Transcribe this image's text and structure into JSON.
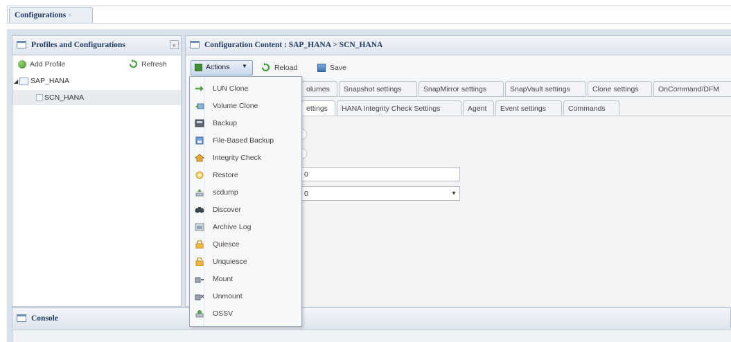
{
  "top_tab": {
    "label": "Configurations",
    "close_glyph": "×"
  },
  "left_panel": {
    "title": "Profiles and Configurations",
    "collapse_glyph": "«",
    "add_profile": "Add Profile",
    "refresh": "Refresh",
    "tree": [
      {
        "label": "SAP_HANA",
        "expanded": true
      },
      {
        "label": "SCN_HANA",
        "selected": true
      }
    ]
  },
  "right_panel": {
    "title": "Configuration Content : SAP_HANA > SCN_HANA",
    "toolbar": {
      "actions": "Actions",
      "reload": "Reload",
      "save": "Save"
    },
    "tabs_row1": [
      "olumes",
      "Snapshot settings",
      "SnapMirror settings",
      "SnapVault settings",
      "Clone settings",
      "OnCommand/DFM"
    ],
    "tabs_row2": [
      "ettings",
      "HANA Integrity Check Settings",
      "Agent",
      "Event settings",
      "Commands"
    ],
    "fields": {
      "text_value": "0",
      "select_value": "0"
    }
  },
  "actions_menu": [
    {
      "label": "LUN Clone",
      "icon": "lun-clone-icon"
    },
    {
      "label": "Volume Clone",
      "icon": "volume-clone-icon"
    },
    {
      "label": "Backup",
      "icon": "backup-icon"
    },
    {
      "label": "File-Based Backup",
      "icon": "file-backup-icon"
    },
    {
      "label": "Integrity Check",
      "icon": "integrity-check-icon"
    },
    {
      "label": "Restore",
      "icon": "restore-icon"
    },
    {
      "label": "scdump",
      "icon": "scdump-icon"
    },
    {
      "label": "Discover",
      "icon": "discover-icon"
    },
    {
      "label": "Archive Log",
      "icon": "archive-log-icon"
    },
    {
      "label": "Quiesce",
      "icon": "quiesce-icon"
    },
    {
      "label": "Unquiesce",
      "icon": "unquiesce-icon"
    },
    {
      "label": "Mount",
      "icon": "mount-icon"
    },
    {
      "label": "Unmount",
      "icon": "unmount-icon"
    },
    {
      "label": "OSSV",
      "icon": "ossv-icon"
    }
  ],
  "console": {
    "title": "Console"
  },
  "colors": {
    "header_text": "#1f3a63",
    "frame": "#d9e1ec",
    "menu_bg": "#f7f8fa"
  }
}
